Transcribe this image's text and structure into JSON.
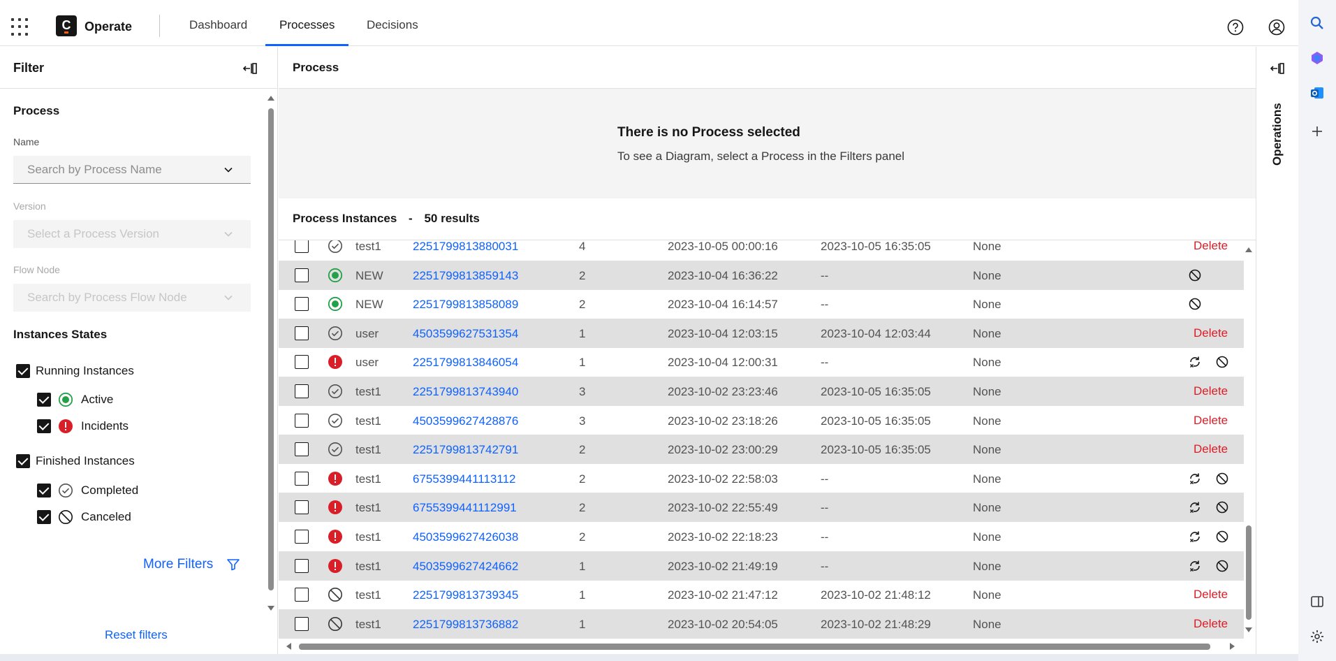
{
  "header": {
    "app_name": "Operate",
    "logo_letter": "C",
    "tabs": [
      {
        "label": "Dashboard",
        "active": false
      },
      {
        "label": "Processes",
        "active": true
      },
      {
        "label": "Decisions",
        "active": false
      }
    ]
  },
  "filter": {
    "title": "Filter",
    "process_section": "Process",
    "name_label": "Name",
    "name_placeholder": "Search by Process Name",
    "version_label": "Version",
    "version_placeholder": "Select a Process Version",
    "flow_node_label": "Flow Node",
    "flow_node_placeholder": "Search by Process Flow Node",
    "states_section": "Instances States",
    "running": "Running Instances",
    "active": "Active",
    "incidents": "Incidents",
    "finished": "Finished Instances",
    "completed": "Completed",
    "canceled": "Canceled",
    "more_filters": "More Filters",
    "reset": "Reset filters"
  },
  "main": {
    "title": "Process",
    "empty_title": "There is no Process selected",
    "empty_text": "To see a Diagram, select a Process in the Filters panel",
    "instances_label": "Process Instances",
    "separator": "-",
    "results": "50 results"
  },
  "operations": {
    "label": "Operations"
  },
  "colors": {
    "accent": "#0f62fe",
    "active": "#24a148",
    "incident": "#da1e28",
    "delete": "#da1e28"
  },
  "rows": [
    {
      "state": "completed",
      "name": "test1",
      "key": "2251799813880031",
      "version": "4",
      "start": "2023-10-05 00:00:16",
      "end": "2023-10-05 16:35:05",
      "parent": "None",
      "action": "delete"
    },
    {
      "state": "active",
      "name": "NEW",
      "key": "2251799813859143",
      "version": "2",
      "start": "2023-10-04 16:36:22",
      "end": "--",
      "parent": "None",
      "action": "cancel"
    },
    {
      "state": "active",
      "name": "NEW",
      "key": "2251799813858089",
      "version": "2",
      "start": "2023-10-04 16:14:57",
      "end": "--",
      "parent": "None",
      "action": "cancel"
    },
    {
      "state": "completed",
      "name": "user",
      "key": "4503599627531354",
      "version": "1",
      "start": "2023-10-04 12:03:15",
      "end": "2023-10-04 12:03:44",
      "parent": "None",
      "action": "delete"
    },
    {
      "state": "incident",
      "name": "user",
      "key": "2251799813846054",
      "version": "1",
      "start": "2023-10-04 12:00:31",
      "end": "--",
      "parent": "None",
      "action": "retry-cancel"
    },
    {
      "state": "completed",
      "name": "test1",
      "key": "2251799813743940",
      "version": "3",
      "start": "2023-10-02 23:23:46",
      "end": "2023-10-05 16:35:05",
      "parent": "None",
      "action": "delete"
    },
    {
      "state": "completed",
      "name": "test1",
      "key": "4503599627428876",
      "version": "3",
      "start": "2023-10-02 23:18:26",
      "end": "2023-10-05 16:35:05",
      "parent": "None",
      "action": "delete"
    },
    {
      "state": "completed",
      "name": "test1",
      "key": "2251799813742791",
      "version": "2",
      "start": "2023-10-02 23:00:29",
      "end": "2023-10-05 16:35:05",
      "parent": "None",
      "action": "delete"
    },
    {
      "state": "incident",
      "name": "test1",
      "key": "6755399441113112",
      "version": "2",
      "start": "2023-10-02 22:58:03",
      "end": "--",
      "parent": "None",
      "action": "retry-cancel"
    },
    {
      "state": "incident",
      "name": "test1",
      "key": "6755399441112991",
      "version": "2",
      "start": "2023-10-02 22:55:49",
      "end": "--",
      "parent": "None",
      "action": "retry-cancel"
    },
    {
      "state": "incident",
      "name": "test1",
      "key": "4503599627426038",
      "version": "2",
      "start": "2023-10-02 22:18:23",
      "end": "--",
      "parent": "None",
      "action": "retry-cancel"
    },
    {
      "state": "incident",
      "name": "test1",
      "key": "4503599627424662",
      "version": "1",
      "start": "2023-10-02 21:49:19",
      "end": "--",
      "parent": "None",
      "action": "retry-cancel"
    },
    {
      "state": "canceled",
      "name": "test1",
      "key": "2251799813739345",
      "version": "1",
      "start": "2023-10-02 21:47:12",
      "end": "2023-10-02 21:48:12",
      "parent": "None",
      "action": "delete"
    },
    {
      "state": "canceled",
      "name": "test1",
      "key": "2251799813736882",
      "version": "1",
      "start": "2023-10-02 20:54:05",
      "end": "2023-10-02 21:48:29",
      "parent": "None",
      "action": "delete"
    }
  ],
  "delete_label": "Delete"
}
